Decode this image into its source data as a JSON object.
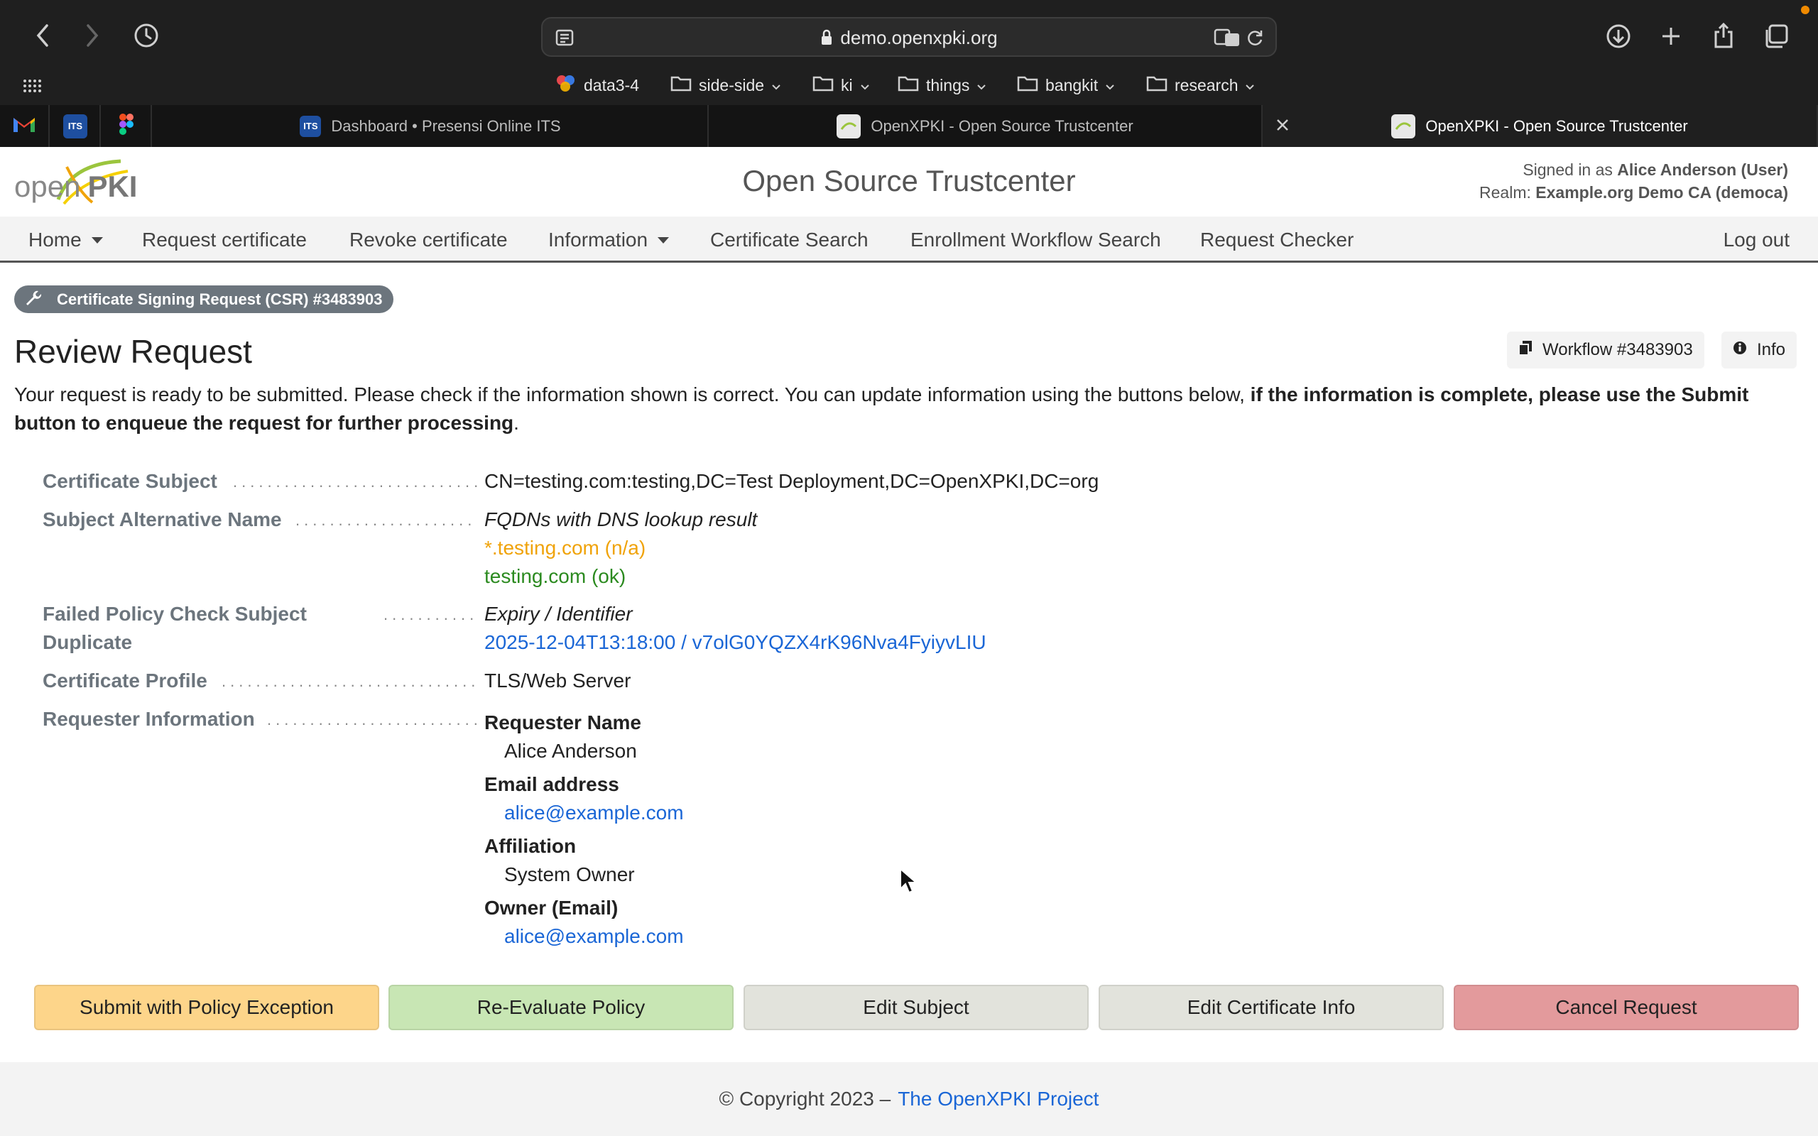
{
  "browser": {
    "url": "demo.openxpki.org",
    "bookmarks": [
      {
        "label": "data3-4"
      },
      {
        "label": "side-side"
      },
      {
        "label": "ki"
      },
      {
        "label": "things"
      },
      {
        "label": "bangkit"
      },
      {
        "label": "research"
      }
    ],
    "tabs": [
      {
        "title": "Dashboard • Presensi Online ITS"
      },
      {
        "title": "OpenXPKI - Open Source Trustcenter"
      },
      {
        "title": "OpenXPKI - Open Source Trustcenter"
      }
    ],
    "pinned_labels": {
      "its": "ITS"
    }
  },
  "header": {
    "logo_text_open": "open",
    "logo_text_pki": "PKI",
    "title": "Open Source Trustcenter",
    "signed_in_prefix": "Signed in as",
    "signed_in_user": "Alice Anderson (User)",
    "realm_prefix": "Realm:",
    "realm_value": "Example.org Demo CA (democa)"
  },
  "nav": {
    "home": "Home",
    "request": "Request certificate",
    "revoke": "Revoke certificate",
    "information": "Information",
    "cert_search": "Certificate Search",
    "workflow_search": "Enrollment Workflow Search",
    "checker": "Request Checker",
    "logout": "Log out"
  },
  "content": {
    "badge": "Certificate Signing Request (CSR) #3483903",
    "title": "Review Request",
    "workflow_btn": "Workflow #3483903",
    "info_btn": "Info",
    "intro_normal": "Your request is ready to be submitted. Please check if the information shown is correct. You can update information using the buttons below,",
    "intro_bold": "if the information is complete, please use the Submit button to enqueue the request for further processing",
    "intro_end": ".",
    "rows": {
      "subject_label": "Certificate Subject",
      "subject_value": "CN=testing.com:testing,DC=Test Deployment,DC=OpenXPKI,DC=org",
      "san_label": "Subject Alternative Name",
      "san_heading": "FQDNs with DNS lookup result",
      "san_item1": "*.testing.com (n/a)",
      "san_item2": "testing.com (ok)",
      "policy_label_1": "Failed Policy Check Subject",
      "policy_label_2": "Duplicate",
      "policy_heading": "Expiry / Identifier",
      "policy_value": "2025-12-04T13:18:00 / v7olG0YQZX4rK96Nva4FyiyvLIU",
      "profile_label": "Certificate Profile",
      "profile_value": "TLS/Web Server",
      "requester_label": "Requester Information",
      "req_name_head": "Requester Name",
      "req_name": "Alice Anderson",
      "req_email_head": "Email address",
      "req_email": "alice@example.com",
      "req_aff_head": "Affiliation",
      "req_aff": "System Owner",
      "req_owner_head": "Owner (Email)",
      "req_owner": "alice@example.com"
    }
  },
  "actions": {
    "submit": "Submit with Policy Exception",
    "reevaluate": "Re-Evaluate Policy",
    "edit_subject": "Edit Subject",
    "edit_info": "Edit Certificate Info",
    "cancel": "Cancel Request"
  },
  "footer": {
    "copyright": "© Copyright 2023 –",
    "link": "The OpenXPKI Project"
  },
  "colors": {
    "submit_bg": "#fdd58a",
    "reevaluate_bg": "#c8e6b4",
    "neutral_bg": "#e2e3dc",
    "cancel_bg": "#e39a9c"
  }
}
